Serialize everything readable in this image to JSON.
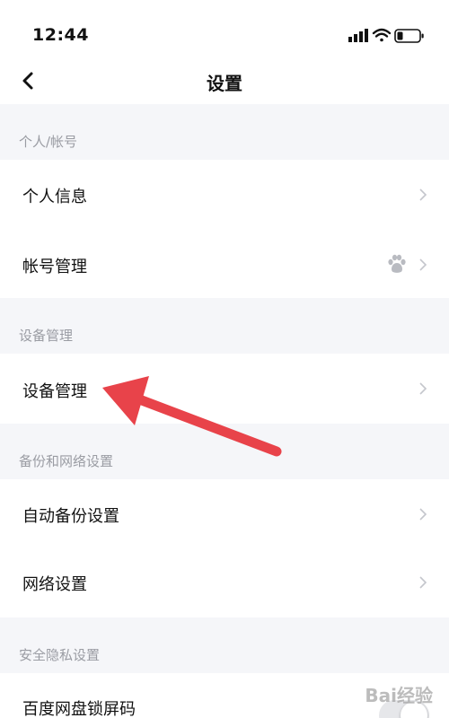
{
  "status_bar": {
    "time": "12:44"
  },
  "nav": {
    "title": "设置",
    "back_icon": "chevron-left-icon"
  },
  "sections": [
    {
      "header": "个人/帐号",
      "items": [
        "个人信息",
        "帐号管理"
      ]
    },
    {
      "header": "设备管理",
      "items": [
        "设备管理"
      ]
    },
    {
      "header": "备份和网络设置",
      "items": [
        "自动备份设置",
        "网络设置"
      ]
    },
    {
      "header": "安全隐私设置",
      "items": [
        "百度网盘锁屏码"
      ]
    }
  ],
  "watermark": "Bai经验",
  "colors": {
    "background": "#f5f6f9",
    "arrow": "#e8434a",
    "section_text": "#9a9ca3"
  }
}
